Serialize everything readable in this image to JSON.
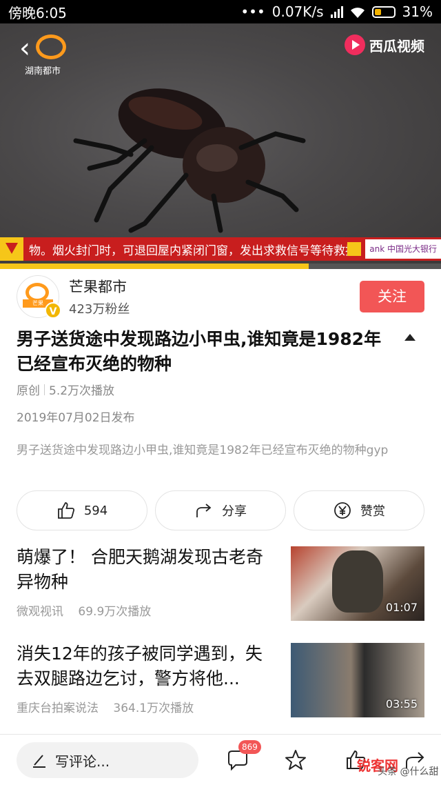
{
  "status_bar": {
    "time": "傍晚6:05",
    "dots": "•••",
    "speed": "0.07K/s",
    "battery": "31%"
  },
  "video": {
    "left_logo_text": "湖南都市",
    "right_logo_text": "西瓜视频",
    "ticker_text": "物。烟火封门时，可退回屋内紧闭门窗，发出求救信号等待救援",
    "bank_text": "ank 中国光大银行",
    "progress_fraction": 0.7
  },
  "channel": {
    "name": "芒果都市",
    "fans": "423万粉丝",
    "follow_label": "关注"
  },
  "article": {
    "title": "男子送货途中发现路边小甲虫,谁知竟是1982年已经宣布灭绝的物种",
    "tag": "原创",
    "plays": "5.2万次播放",
    "date": "2019年07月02日发布",
    "description": "男子送货途中发现路边小甲虫,谁知竟是1982年已经宣布灭绝的物种gyp"
  },
  "actions": {
    "like_count": "594",
    "share_label": "分享",
    "reward_label": "赞赏"
  },
  "related": [
    {
      "title": "萌爆了！ 合肥天鹅湖发现古老奇异物种",
      "source": "微观视讯",
      "plays": "69.9万次播放",
      "duration": "01:07"
    },
    {
      "title": "消失12年的孩子被同学遇到，失去双腿路边乞讨，警方将他...",
      "source": "重庆台拍案说法",
      "plays": "364.1万次播放",
      "duration": "03:55"
    }
  ],
  "bottom_bar": {
    "comment_placeholder": "写评论...",
    "comment_count": "869",
    "watermark_logo": "锐客网",
    "watermark_text": "头条 @什么甜"
  }
}
